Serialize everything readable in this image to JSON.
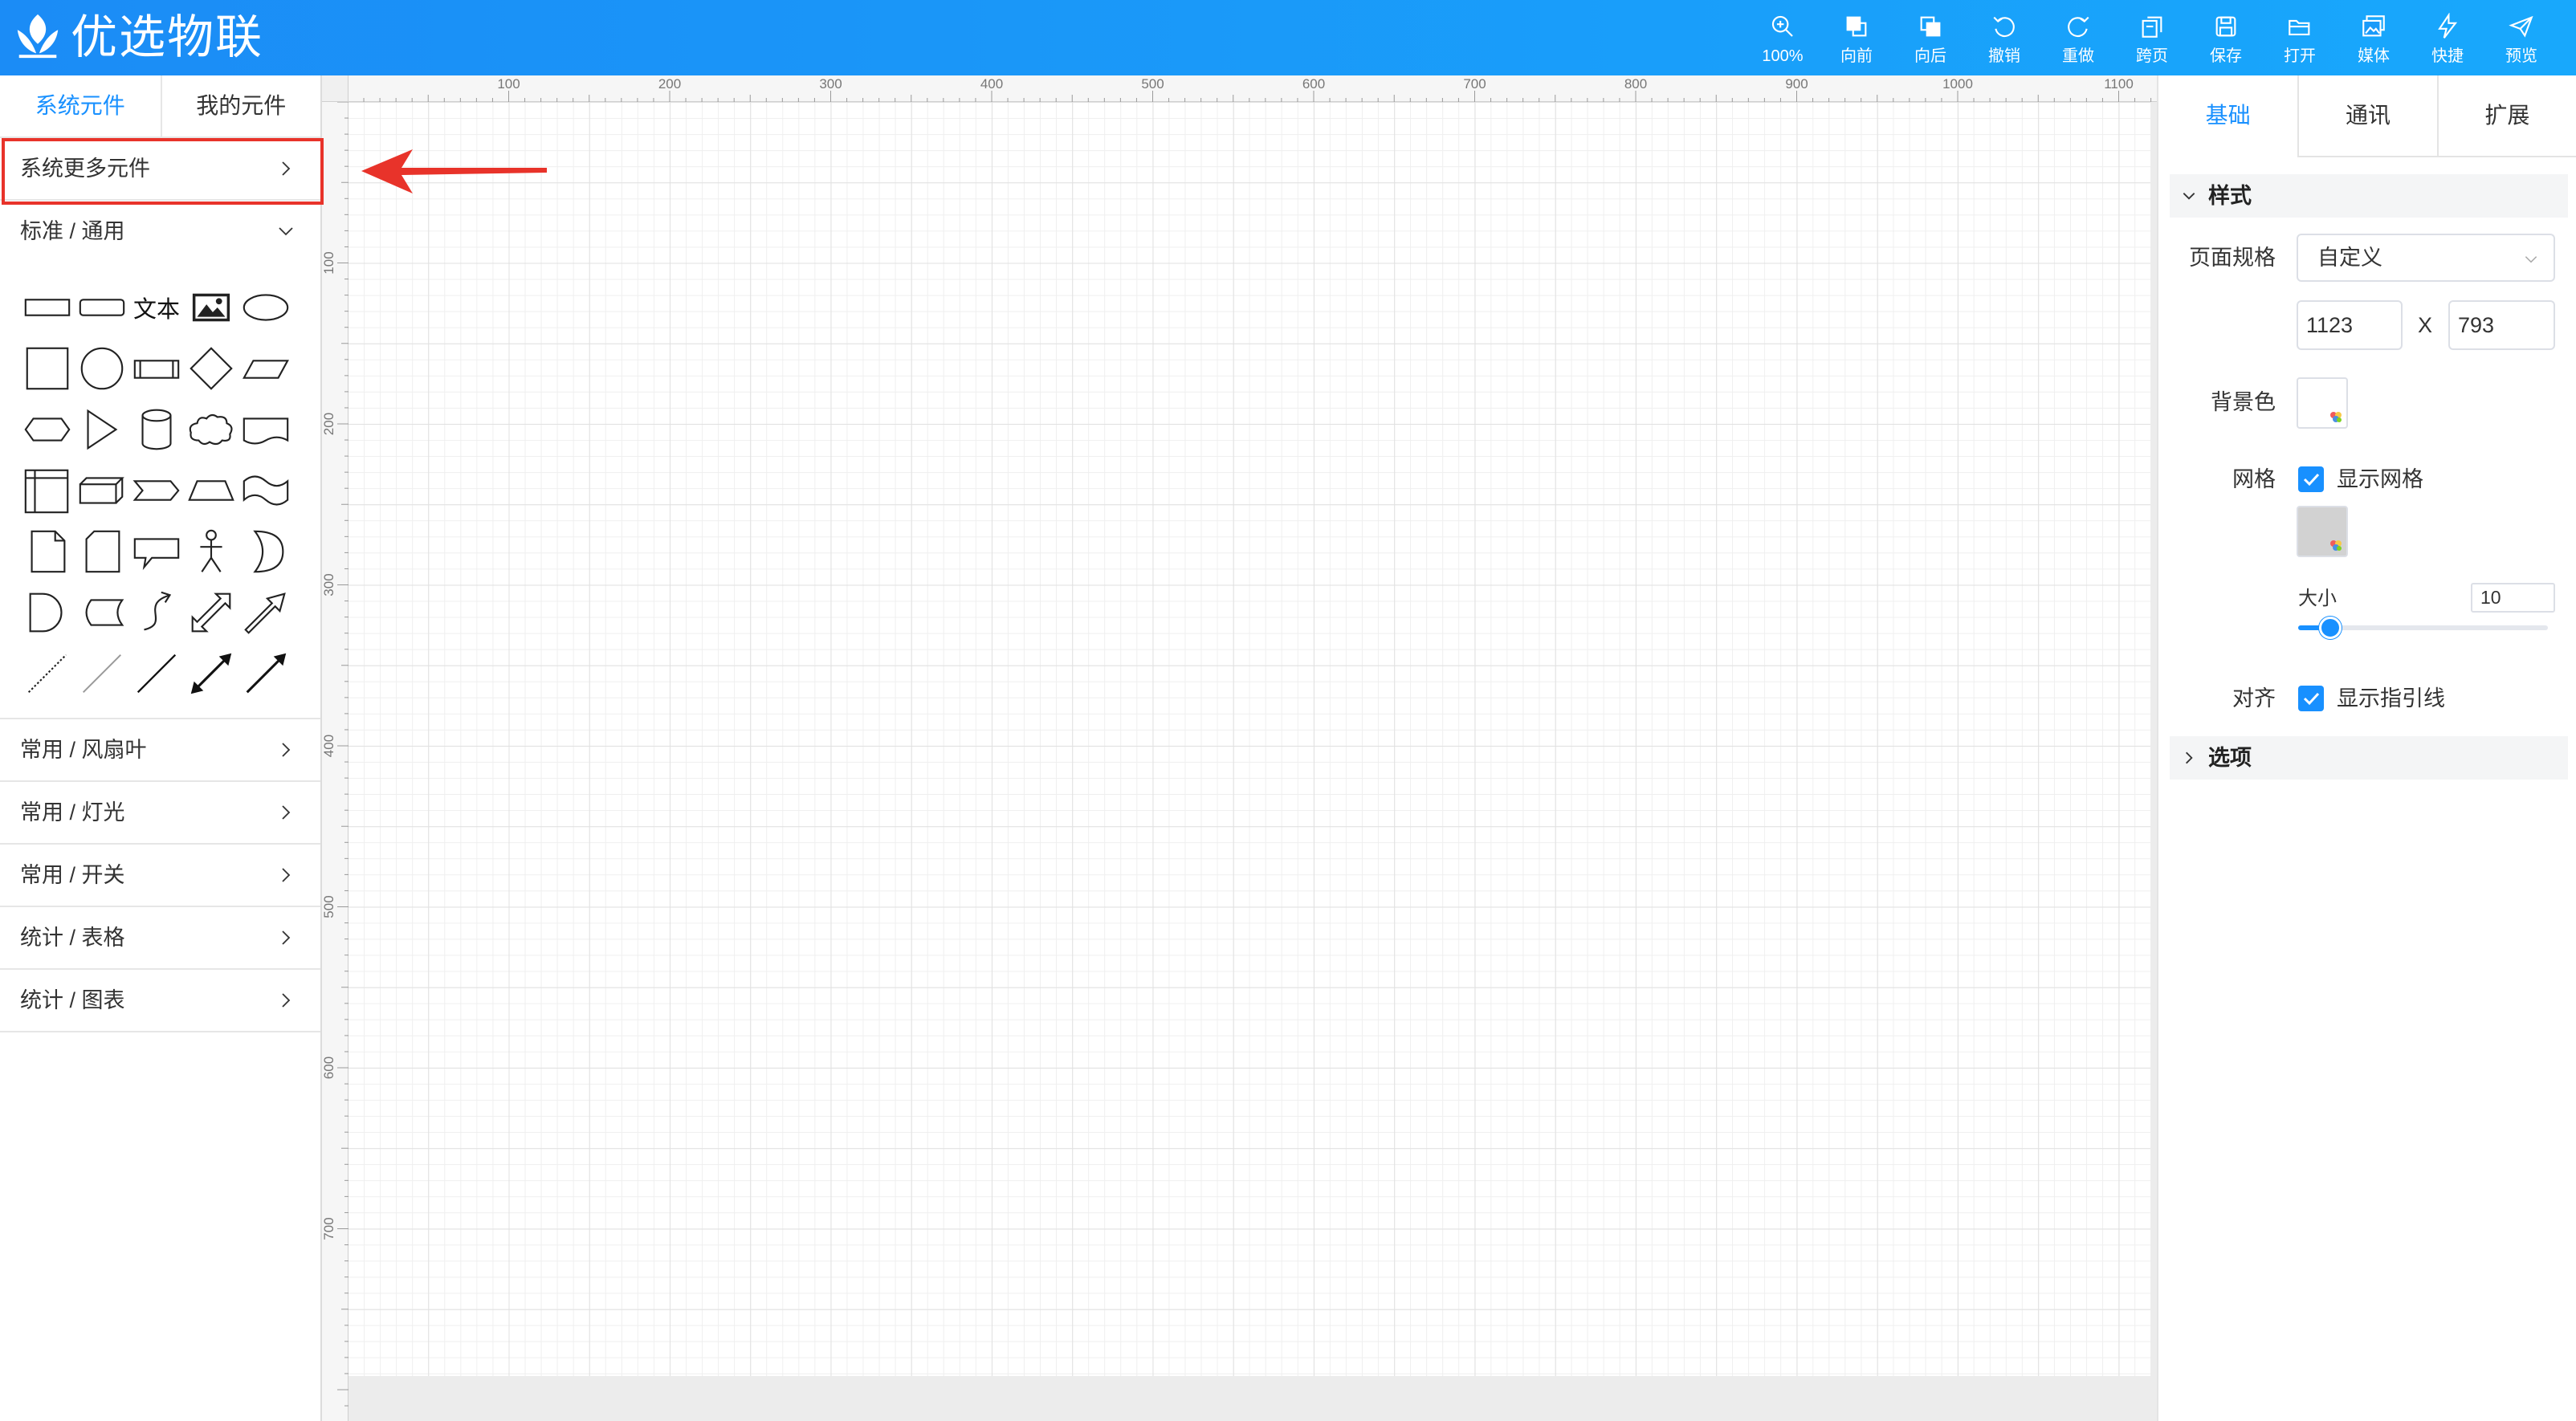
{
  "app": {
    "title": "优选物联",
    "logo_icon": "leaf-logo-icon"
  },
  "toolbar": [
    {
      "icon": "zoom-in-icon",
      "label": "100%"
    },
    {
      "icon": "bring-forward-icon",
      "label": "向前"
    },
    {
      "icon": "send-backward-icon",
      "label": "向后"
    },
    {
      "icon": "undo-icon",
      "label": "撤销"
    },
    {
      "icon": "redo-icon",
      "label": "重做"
    },
    {
      "icon": "cross-page-icon",
      "label": "跨页"
    },
    {
      "icon": "save-icon",
      "label": "保存"
    },
    {
      "icon": "open-folder-icon",
      "label": "打开"
    },
    {
      "icon": "media-icon",
      "label": "媒体"
    },
    {
      "icon": "lightning-icon",
      "label": "快捷"
    },
    {
      "icon": "paper-plane-icon",
      "label": "预览"
    }
  ],
  "left": {
    "tabs": [
      {
        "label": "系统元件",
        "active": true
      },
      {
        "label": "我的元件",
        "active": false
      }
    ],
    "more": {
      "label": "系统更多元件",
      "icon": "chevron-right-icon"
    },
    "standard": {
      "label": "标准 / 通用",
      "icon": "chevron-down-icon"
    },
    "palette": [
      {
        "icon": "rectangle-icon"
      },
      {
        "icon": "rounded-rectangle-icon"
      },
      {
        "icon": "text-shape-icon",
        "text": "文本"
      },
      {
        "icon": "image-icon"
      },
      {
        "icon": "ellipse-icon"
      },
      {
        "icon": "square-icon"
      },
      {
        "icon": "circle-icon"
      },
      {
        "icon": "process-icon"
      },
      {
        "icon": "diamond-icon"
      },
      {
        "icon": "parallelogram-icon"
      },
      {
        "icon": "hexagon-icon"
      },
      {
        "icon": "triangle-icon"
      },
      {
        "icon": "cylinder-icon"
      },
      {
        "icon": "cloud-icon"
      },
      {
        "icon": "document-icon"
      },
      {
        "icon": "internal-storage-icon"
      },
      {
        "icon": "cube-icon"
      },
      {
        "icon": "step-icon"
      },
      {
        "icon": "trapezoid-icon"
      },
      {
        "icon": "tape-icon"
      },
      {
        "icon": "note-icon"
      },
      {
        "icon": "card-icon"
      },
      {
        "icon": "callout-icon"
      },
      {
        "icon": "actor-icon"
      },
      {
        "icon": "or-icon"
      },
      {
        "icon": "delay-icon"
      },
      {
        "icon": "data-storage-icon"
      },
      {
        "icon": "curve-arrow-icon"
      },
      {
        "icon": "double-arrow-icon"
      },
      {
        "icon": "single-arrow-icon"
      },
      {
        "icon": "dotted-line-icon"
      },
      {
        "icon": "thin-line-icon"
      },
      {
        "icon": "line-icon"
      },
      {
        "icon": "double-arrow-line-icon"
      },
      {
        "icon": "arrow-line-icon"
      }
    ],
    "sections": [
      {
        "label": "常用 / 风扇叶"
      },
      {
        "label": "常用 / 灯光"
      },
      {
        "label": "常用 / 开关"
      },
      {
        "label": "统计 / 表格"
      },
      {
        "label": "统计 / 图表"
      }
    ]
  },
  "ruler": {
    "x": [
      "100",
      "200",
      "300",
      "400",
      "500",
      "600",
      "700",
      "800",
      "900",
      "1000",
      "1100"
    ],
    "y": [
      "100",
      "200",
      "300",
      "400",
      "500",
      "600",
      "700"
    ]
  },
  "right": {
    "tabs": [
      {
        "label": "基础",
        "active": true
      },
      {
        "label": "通讯",
        "active": false
      },
      {
        "label": "扩展",
        "active": false
      }
    ],
    "style_section": {
      "title": "样式",
      "icon": "chevron-down-icon"
    },
    "page_size": {
      "label": "页面规格",
      "value": "自定义",
      "width": "1123",
      "height": "793",
      "separator": "X"
    },
    "background": {
      "label": "背景色",
      "color": "#ffffff"
    },
    "grid": {
      "label": "网格",
      "checkbox_label": "显示网格",
      "checked": true,
      "color": "#d2d2d2",
      "size_label": "大小",
      "size": "10",
      "slider_fraction": 0.13
    },
    "align": {
      "label": "对齐",
      "checkbox_label": "显示指引线",
      "checked": true
    },
    "options_section": {
      "title": "选项",
      "icon": "chevron-right-icon"
    }
  },
  "colors": {
    "accent": "#1890ff",
    "highlight": "#e8332a",
    "header": "#1a9bfa"
  }
}
